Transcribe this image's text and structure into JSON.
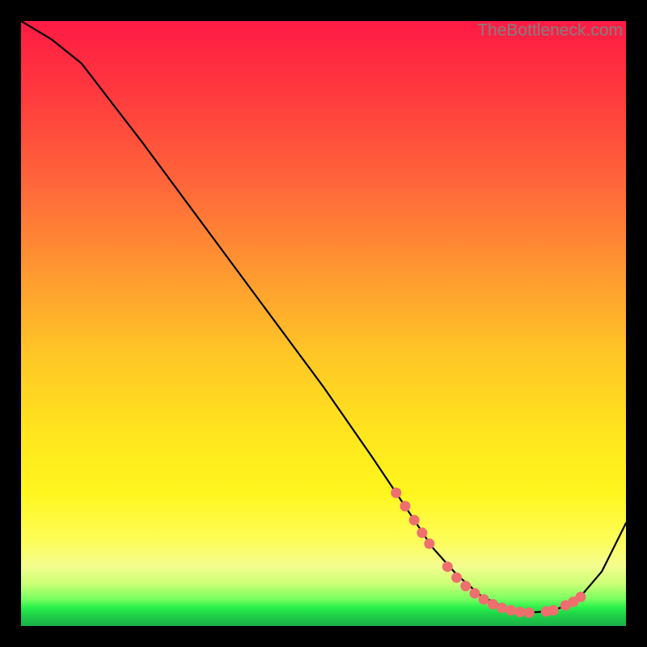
{
  "watermark": "TheBottleneck.com",
  "colors": {
    "point": "#ef6e6e",
    "line": "#000000",
    "frame": "#000000"
  },
  "chart_data": {
    "type": "line",
    "title": "",
    "xlabel": "",
    "ylabel": "",
    "xlim": [
      0,
      100
    ],
    "ylim": [
      0,
      100
    ],
    "grid": false,
    "series": [
      {
        "name": "curve",
        "x": [
          0,
          5,
          10,
          20,
          30,
          40,
          50,
          58,
          62,
          68,
          72,
          76,
          80,
          84,
          88,
          92,
          96,
          100
        ],
        "y": [
          100,
          97,
          93,
          80,
          66.5,
          53,
          39.5,
          28,
          22,
          13,
          8.5,
          5,
          3,
          2.2,
          2.5,
          4.3,
          9,
          17
        ]
      }
    ],
    "markers": [
      {
        "x": 62.0,
        "y": 22.0
      },
      {
        "x": 63.5,
        "y": 19.8
      },
      {
        "x": 65.0,
        "y": 17.5
      },
      {
        "x": 66.3,
        "y": 15.4
      },
      {
        "x": 67.5,
        "y": 13.6
      },
      {
        "x": 70.5,
        "y": 9.8
      },
      {
        "x": 72.0,
        "y": 8.0
      },
      {
        "x": 73.5,
        "y": 6.6
      },
      {
        "x": 75.0,
        "y": 5.4
      },
      {
        "x": 76.5,
        "y": 4.4
      },
      {
        "x": 78.0,
        "y": 3.6
      },
      {
        "x": 79.5,
        "y": 3.0
      },
      {
        "x": 81.0,
        "y": 2.6
      },
      {
        "x": 82.5,
        "y": 2.3
      },
      {
        "x": 84.0,
        "y": 2.2
      },
      {
        "x": 86.8,
        "y": 2.4
      },
      {
        "x": 88.0,
        "y": 2.6
      },
      {
        "x": 90.0,
        "y": 3.4
      },
      {
        "x": 91.3,
        "y": 4.0
      },
      {
        "x": 92.5,
        "y": 4.8
      }
    ]
  }
}
